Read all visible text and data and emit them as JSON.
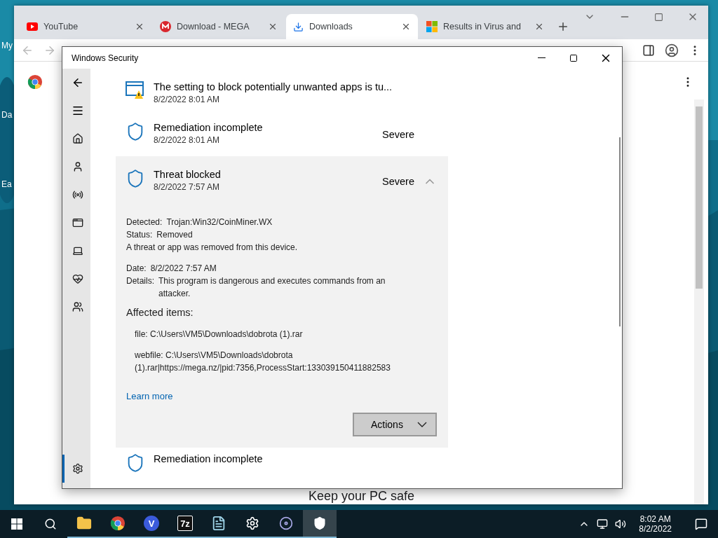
{
  "desktop": {
    "icon_labels": [
      "My",
      "Da",
      "Ea"
    ]
  },
  "browser": {
    "tabs": [
      {
        "title": "YouTube",
        "kind": "youtube",
        "selected": false
      },
      {
        "title": "Download - MEGA",
        "kind": "mega",
        "selected": false
      },
      {
        "title": "Downloads",
        "kind": "download",
        "selected": true
      },
      {
        "title": "Results in Virus and",
        "kind": "microsoft",
        "selected": false
      }
    ],
    "page_footer": "Keep your PC safe"
  },
  "security": {
    "title": "Windows Security",
    "nav": [
      {
        "kind": "home",
        "selected": false
      },
      {
        "kind": "account",
        "selected": false
      },
      {
        "kind": "network",
        "selected": false
      },
      {
        "kind": "app",
        "selected": false
      },
      {
        "kind": "device",
        "selected": false
      },
      {
        "kind": "health",
        "selected": false
      },
      {
        "kind": "family",
        "selected": false
      },
      {
        "kind": "settings",
        "selected": true
      }
    ],
    "history": [
      {
        "kind": "app-warning",
        "title": "The setting to block potentially unwanted apps is tu...",
        "time": "8/2/2022 8:01 AM",
        "expanded": false
      },
      {
        "kind": "shield",
        "title": "Remediation incomplete",
        "time": "8/2/2022 8:01 AM",
        "severity": "Severe",
        "expanded": false
      },
      {
        "kind": "shield",
        "title": "Threat blocked",
        "time": "8/2/2022 7:57 AM",
        "severity": "Severe",
        "expanded": true
      },
      {
        "kind": "shield",
        "title": "Remediation incomplete",
        "expanded": false
      }
    ],
    "details": {
      "group1": [
        {
          "label": "Detected:",
          "value": "Trojan:Win32/CoinMiner.WX"
        },
        {
          "label": "Status:",
          "value": "Removed"
        }
      ],
      "note": "A threat or app was removed from this device.",
      "group2": [
        {
          "label": "Date:",
          "value": "8/2/2022 7:57 AM"
        },
        {
          "label": "Details:",
          "value": "This program is dangerous and executes commands from an attacker."
        }
      ],
      "affected_heading": "Affected items:",
      "affected": [
        "file: C:\\Users\\VM5\\Downloads\\dobrota (1).rar",
        "webfile: C:\\Users\\VM5\\Downloads\\dobrota (1).rar|https://mega.nz/|pid:7356,ProcessStart:133039150411882583"
      ],
      "link": "Learn more",
      "action": "Actions"
    }
  },
  "taskbar": {
    "apps": [
      {
        "kind": "folder",
        "selected": false
      },
      {
        "kind": "chrome",
        "selected": false
      },
      {
        "kind": "v-app",
        "label": "V",
        "selected": false
      },
      {
        "kind": "archive",
        "label": "7z",
        "selected": false
      },
      {
        "kind": "notepad",
        "selected": false
      },
      {
        "kind": "settings",
        "selected": false
      },
      {
        "kind": "media",
        "selected": false
      },
      {
        "kind": "shield",
        "selected": true
      }
    ],
    "time": "8:02 AM",
    "date": "8/2/2022"
  }
}
